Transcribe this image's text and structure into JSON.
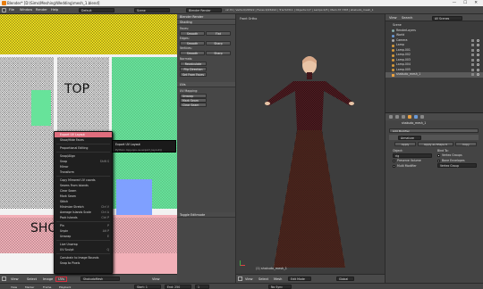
{
  "titlebar": {
    "title": "Blender* [D:\\Sims\\Meshing\\Wedding\\mesh_1.blend]",
    "min": "—",
    "max": "☐",
    "close": "✕"
  },
  "menubar": {
    "items": [
      "File",
      "Window",
      "Render",
      "Help"
    ],
    "screen_layout": "Default",
    "scene": "Scene",
    "engine": "Blender Render",
    "info": "v2.70 | Verts:0/26522 | Faces:0/26192 | Tris:52311 | Objects:1/7 | Lamps:0/3 | Mem:37.73M | shakudo_mesh_1"
  },
  "uv_editor": {
    "label_top": "TOP",
    "label_bottom": "SHO",
    "footer": [
      "View",
      "Select",
      "Image",
      "UVs"
    ],
    "footer_field": "ShakudoMesh",
    "view_label": "View"
  },
  "tools": {
    "tab": "Blender Render",
    "panel1": "Shading",
    "faces_label": "Faces:",
    "smooth": "Smooth",
    "flat": "Flat",
    "edges_label": "Edges:",
    "sharp": "Sharp",
    "vertices_label": "Vertices:",
    "normals_label": "Normals:",
    "recalculate": "Recalculate",
    "flip_direction": "Flip Direction",
    "set_from_faces": "Set From Faces",
    "panel2": "UVs",
    "uv_mapping_label": "UV Mapping:",
    "unwrap": "Unwrap",
    "mark_seam": "Mark Seam",
    "clear_seam": "Clear Seam",
    "toggle_panel": "Toggle Editmode"
  },
  "context_menu": {
    "items": [
      {
        "label": "Export UV Layout",
        "sc": "",
        "hl": true
      },
      {
        "label": "Show/Hide Faces",
        "sc": ""
      },
      {
        "label": "",
        "sep": true
      },
      {
        "label": "Proportional Editing",
        "sc": ""
      },
      {
        "label": "",
        "sep": true
      },
      {
        "label": "Snap/Align",
        "sc": ""
      },
      {
        "label": "Snap",
        "sc": "Shift S"
      },
      {
        "label": "Mirror",
        "sc": ""
      },
      {
        "label": "Transform",
        "sc": ""
      },
      {
        "label": "",
        "sep": true
      },
      {
        "label": "Copy Mirrored UV coords",
        "sc": ""
      },
      {
        "label": "Seams From Islands",
        "sc": ""
      },
      {
        "label": "Clear Seam",
        "sc": ""
      },
      {
        "label": "Mark Seam",
        "sc": ""
      },
      {
        "label": "Stitch",
        "sc": ""
      },
      {
        "label": "Minimize Stretch",
        "sc": "Ctrl V"
      },
      {
        "label": "Average Islands Scale",
        "sc": "Ctrl A"
      },
      {
        "label": "Pack Islands",
        "sc": "Ctrl P"
      },
      {
        "label": "",
        "sep": true
      },
      {
        "label": "Pin",
        "sc": "P"
      },
      {
        "label": "Unpin",
        "sc": "Alt P"
      },
      {
        "label": "Unwrap",
        "sc": "E"
      },
      {
        "label": "",
        "sep": true
      },
      {
        "label": "Live Unwrap",
        "sc": ""
      },
      {
        "label": "UV Sculpt",
        "sc": "Q"
      },
      {
        "label": "",
        "sep": true
      },
      {
        "label": "Constrain to Image Bounds",
        "sc": ""
      },
      {
        "label": "Snap to Pixels",
        "sc": ""
      }
    ]
  },
  "tooltip": {
    "line1": "Export UV Layout",
    "line2": "Python: bpy.ops.uv.export_layout()"
  },
  "viewport": {
    "label": "Front Ortho",
    "object_label": "(1) shakudo_mesh_1",
    "footer": [
      "View",
      "Select",
      "Mesh"
    ],
    "mode": "Edit Mode",
    "pivot": "Global"
  },
  "outliner": {
    "header": [
      "View",
      "Search",
      "All Scenes"
    ],
    "items": [
      {
        "label": "Scene",
        "depth": 0
      },
      {
        "label": "RenderLayers",
        "depth": 1
      },
      {
        "label": "World",
        "depth": 1
      },
      {
        "label": "Camera",
        "depth": 1
      },
      {
        "label": "Lamp",
        "depth": 1
      },
      {
        "label": "Lamp.001",
        "depth": 1
      },
      {
        "label": "Lamp.002",
        "depth": 1
      },
      {
        "label": "Lamp.003",
        "depth": 1
      },
      {
        "label": "Lamp.004",
        "depth": 1
      },
      {
        "label": "Lamp.005",
        "depth": 1
      },
      {
        "label": "shakudo_mesh_1",
        "depth": 1
      }
    ]
  },
  "properties": {
    "object_name": "shakudo_mesh_1",
    "add_modifier": "Add Modifier",
    "modifier_name": "Armature",
    "apply": "Apply",
    "apply_as": "Apply as Shape K",
    "copy": "Copy",
    "object_label": "Object:",
    "object_value": "rig",
    "bind_to": "Bind To:",
    "preserve_volume": "Preserve Volume",
    "vertex_groups": "Vertex Groups",
    "multi_modifier": "Multi Modifier",
    "bone_envelopes": "Bone Envelopes",
    "vertex_group_label": "Vertex Group"
  },
  "timeline": {
    "items": [
      "View",
      "Marker",
      "Frame",
      "Playback"
    ],
    "start": "Start: 1",
    "end": "End: 250",
    "current": "1",
    "sync": "No Sync"
  }
}
